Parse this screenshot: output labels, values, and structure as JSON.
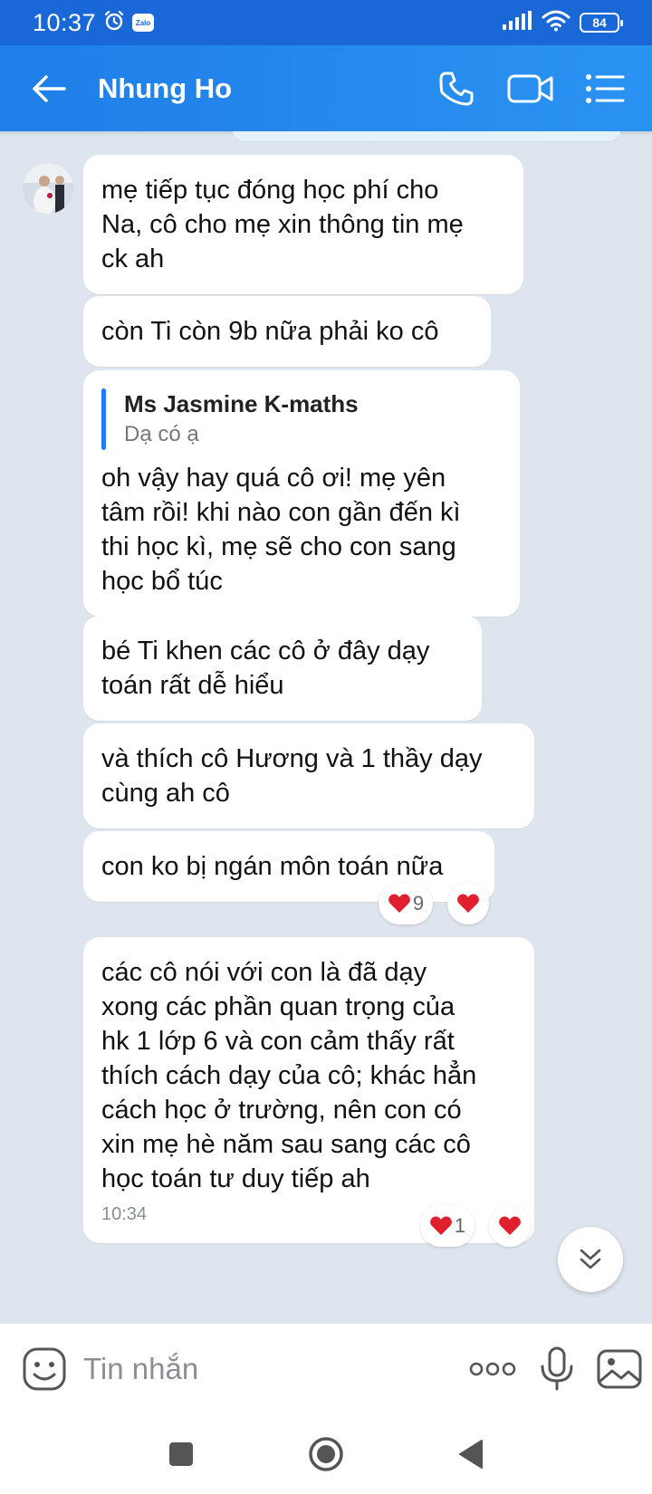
{
  "status_bar": {
    "time": "10:37",
    "app_badge": "Zalo",
    "battery": "84"
  },
  "header": {
    "contact_name": "Nhung Ho"
  },
  "messages": [
    {
      "text": "mẹ tiếp tục đóng học phí cho\nNa, cô cho mẹ xin thông tin mẹ\nck ah"
    },
    {
      "text": "còn Ti còn 9b nữa phải ko cô"
    },
    {
      "quote_author": "Ms Jasmine K-maths",
      "quote_text": "Dạ có ạ",
      "text": "oh vậy hay quá cô ơi!  mẹ yên\ntâm rồi! khi nào con gần đến kì\nthi học kì, mẹ sẽ cho con sang\nhọc bổ túc"
    },
    {
      "text": "bé Ti khen các cô ở đây dạy\ntoán rất dễ hiểu"
    },
    {
      "text": "và thích cô Hương và 1 thầy dạy\ncùng ah cô"
    },
    {
      "text": "con ko bị ngán môn toán nữa",
      "reaction_count": "9"
    },
    {
      "text": "các cô nói với con là đã dạy\nxong các phần quan trọng của\nhk 1 lớp 6 và con cảm thấy rất\nthích cách dạy của cô; khác hẳn\ncách học ở trường, nên con có\nxin mẹ hè năm sau sang các cô\nhọc toán tư duy tiếp ah",
      "time": "10:34",
      "reaction_count": "1"
    }
  ],
  "input": {
    "placeholder": "Tin nhắn"
  },
  "colors": {
    "header": "#1f7ee8",
    "status_bar": "#1a67d8",
    "chat_bg": "#dfe5ee",
    "heart": "#e0202e",
    "quote_bar": "#1c7ef0"
  },
  "icons": [
    "alarm-icon",
    "signal-icon",
    "wifi-icon",
    "back-arrow-icon",
    "phone-icon",
    "video-icon",
    "menu-icon",
    "heart-icon",
    "chevron-down-icon",
    "emoji-icon",
    "more-icon",
    "microphone-icon",
    "image-icon",
    "recents-icon",
    "home-icon",
    "back-triangle-icon"
  ]
}
